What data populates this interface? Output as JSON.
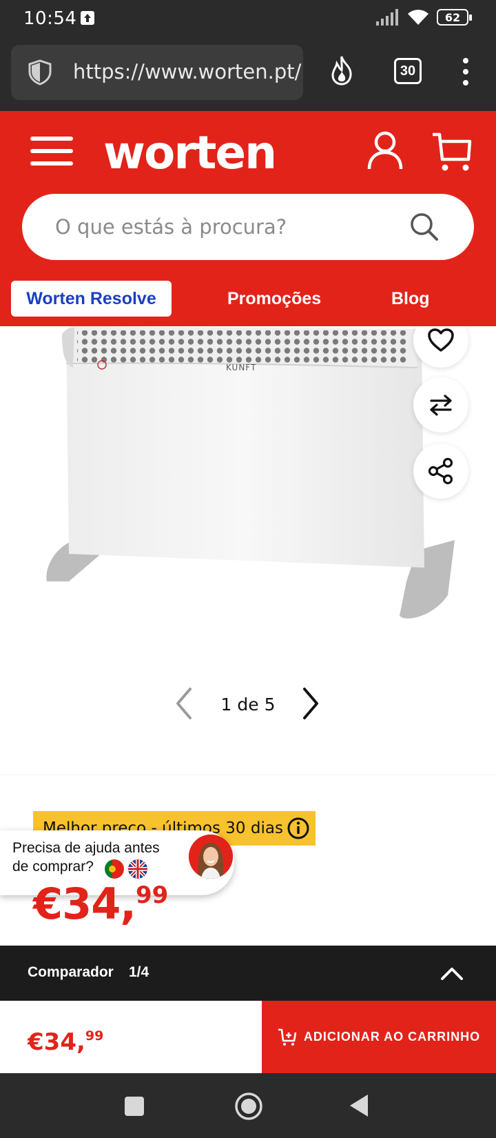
{
  "status_bar": {
    "time": "10:54",
    "battery": "62"
  },
  "browser": {
    "url": "https://www.worten.pt/pr",
    "tab_count": "30"
  },
  "header": {
    "logo": "worten",
    "search_placeholder": "O que estás à procura?",
    "nav": [
      "Worten Resolve",
      "Promoções",
      "Blog"
    ]
  },
  "product": {
    "brand_label": "KUNFT",
    "pager": "1 de 5"
  },
  "pricing": {
    "best_price_label": "Melhor preço - últimos 30 dias",
    "help_text_line1": "Precisa de ajuda antes",
    "help_text_line2": "de comprar?",
    "price_whole": "€34,",
    "price_cents": "99"
  },
  "comparator": {
    "label": "Comparador",
    "count": "1/4"
  },
  "cta": {
    "price_whole": "€34,",
    "price_cents": "99",
    "add_to_cart": "ADICIONAR AO CARRINHO"
  },
  "colors": {
    "brand_red": "#e2231a",
    "badge_yellow": "#f8c22e",
    "resolve_blue": "#1a3fbf"
  }
}
